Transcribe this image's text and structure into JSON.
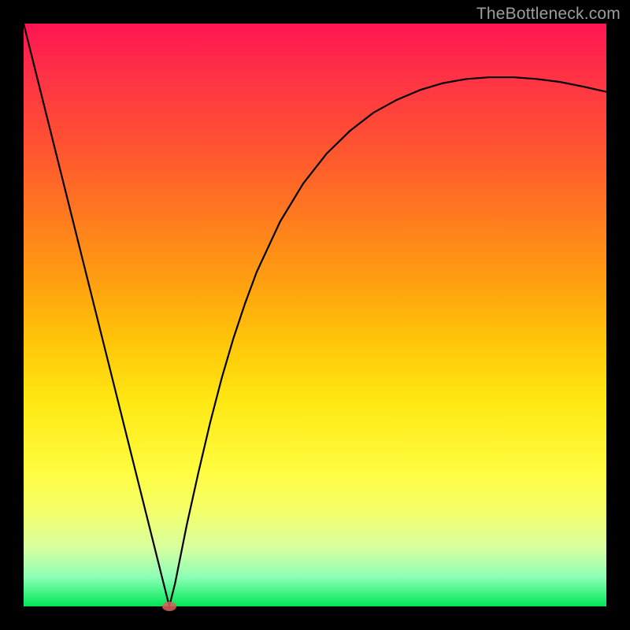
{
  "watermark": "TheBottleneck.com",
  "chart_data": {
    "type": "line",
    "title": "",
    "xlabel": "",
    "ylabel": "",
    "x": [
      0.0,
      0.02,
      0.04,
      0.06,
      0.08,
      0.1,
      0.12,
      0.14,
      0.16,
      0.18,
      0.2,
      0.22,
      0.24,
      0.25,
      0.26,
      0.28,
      0.3,
      0.32,
      0.34,
      0.36,
      0.38,
      0.4,
      0.44,
      0.48,
      0.52,
      0.56,
      0.6,
      0.64,
      0.68,
      0.72,
      0.76,
      0.8,
      0.84,
      0.88,
      0.92,
      0.96,
      1.0
    ],
    "values": [
      1.0,
      0.92,
      0.84,
      0.76,
      0.68,
      0.6,
      0.52,
      0.44,
      0.36,
      0.28,
      0.2,
      0.12,
      0.04,
      0.0,
      0.04,
      0.14,
      0.23,
      0.315,
      0.392,
      0.46,
      0.52,
      0.574,
      0.66,
      0.726,
      0.777,
      0.816,
      0.847,
      0.869,
      0.886,
      0.898,
      0.905,
      0.908,
      0.908,
      0.905,
      0.9,
      0.892,
      0.883
    ],
    "xlim": [
      0,
      1
    ],
    "ylim": [
      0,
      1
    ],
    "min_marker": {
      "x": 0.25,
      "y": 0.0
    },
    "gradient_stops": [
      {
        "pos": 0.0,
        "color": "#ff1452"
      },
      {
        "pos": 0.08,
        "color": "#ff2f47"
      },
      {
        "pos": 0.2,
        "color": "#ff5033"
      },
      {
        "pos": 0.33,
        "color": "#ff7a1f"
      },
      {
        "pos": 0.45,
        "color": "#ffa20f"
      },
      {
        "pos": 0.55,
        "color": "#ffc708"
      },
      {
        "pos": 0.65,
        "color": "#ffe814"
      },
      {
        "pos": 0.77,
        "color": "#fffd41"
      },
      {
        "pos": 0.84,
        "color": "#f3ff6d"
      },
      {
        "pos": 0.9,
        "color": "#d7ffa0"
      },
      {
        "pos": 0.95,
        "color": "#8cffb6"
      },
      {
        "pos": 1.0,
        "color": "#00e756"
      }
    ]
  }
}
